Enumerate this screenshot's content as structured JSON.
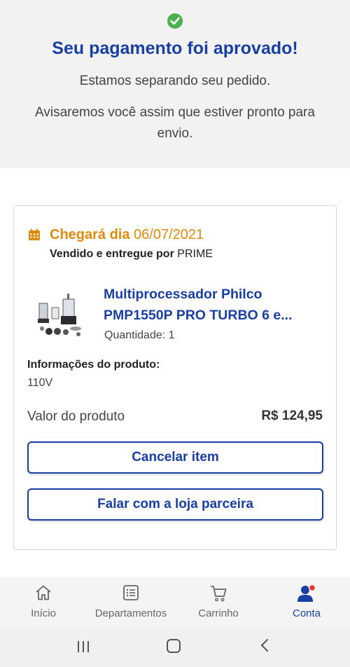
{
  "header": {
    "success_icon": "check-circle-icon",
    "title": "Seu pagamento foi aprovado!",
    "line1": "Estamos separando seu pedido.",
    "line2": "Avisaremos você assim que estiver pronto para envio."
  },
  "order": {
    "calendar_icon": "calendar-icon",
    "arrival_prefix": "Chegará dia",
    "arrival_date": "06/07/2021",
    "seller_prefix": "Vendido e entregue por",
    "seller_name": "PRIME",
    "product_name": "Multiprocessador Philco PMP1550P PRO TURBO 6 e...",
    "quantity": "Quantidade: 1",
    "info_label": "Informações do produto:",
    "info_value": "110V",
    "value_label": "Valor do produto",
    "value_price": "R$ 124,95",
    "cancel_label": "Cancelar item",
    "contact_label": "Falar com a loja parceira"
  },
  "tabs": [
    {
      "label": "Início",
      "icon": "home-icon",
      "active": false
    },
    {
      "label": "Departamentos",
      "icon": "list-icon",
      "active": false
    },
    {
      "label": "Carrinho",
      "icon": "cart-icon",
      "active": false
    },
    {
      "label": "Conta",
      "icon": "user-icon",
      "active": true
    }
  ],
  "colors": {
    "brand_blue": "#1a3fa3",
    "arrival_orange": "#e08a0b",
    "success_green": "#4caf50",
    "notification_red": "#e53935"
  }
}
